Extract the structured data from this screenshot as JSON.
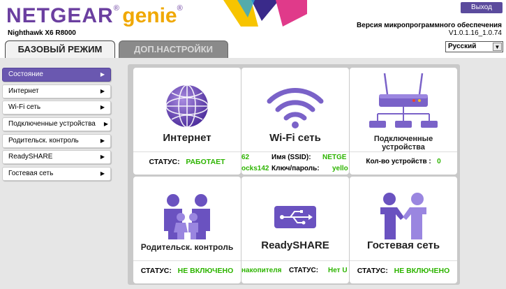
{
  "header": {
    "brand": "NETGEAR",
    "genie": "genie",
    "reg": "®",
    "model": "Nighthawk X6 R8000",
    "logout_label": "Выход",
    "firmware_label": "Версия микропрограммного обеспечения",
    "firmware_version": "V1.0.1.16_1.0.74",
    "language": "Русский"
  },
  "tabs": [
    {
      "label": "БАЗОВЫЙ РЕЖИМ",
      "active": true
    },
    {
      "label": "ДОП.НАСТРОЙКИ",
      "active": false
    }
  ],
  "sidebar": {
    "items": [
      {
        "label": "Состояние",
        "active": true
      },
      {
        "label": "Интернет"
      },
      {
        "label": "Wi-Fi сеть"
      },
      {
        "label": "Подключенные устройства"
      },
      {
        "label": "Родительск. контроль"
      },
      {
        "label": "ReadySHARE"
      },
      {
        "label": "Гостевая сеть"
      }
    ]
  },
  "tiles": {
    "internet": {
      "title": "Интернет",
      "status_label": "СТАТУС:",
      "status_value": "РАБОТАЕТ"
    },
    "wifi": {
      "title": "Wi-Fi сеть",
      "ssid_prefix": "62",
      "ssid_label": "Имя (SSID):",
      "ssid_value": "NETGE",
      "key_prefix": "ocks142",
      "key_label": "Ключ/пароль:",
      "key_value": "yello"
    },
    "devices": {
      "title_line1": "Подключенные",
      "title_line2": "устройства",
      "count_label": "Кол-во устройств :",
      "count_value": "0"
    },
    "parental": {
      "title": "Родительск. контроль",
      "status_label": "СТАТУС:",
      "status_value": "НЕ ВКЛЮЧЕНО"
    },
    "readyshare": {
      "title": "ReadySHARE",
      "left_fragment": "накопителя",
      "status_label": "СТАТУС:",
      "status_value": "Нет U"
    },
    "guest": {
      "title": "Гостевая сеть",
      "status_label": "СТАТУС:",
      "status_value": "НЕ ВКЛЮЧЕНО"
    }
  },
  "colors": {
    "brand_purple": "#6b3fa0",
    "genie_orange": "#f0a800",
    "status_green": "#2db400",
    "active_sidebar": "#6a58b0"
  }
}
